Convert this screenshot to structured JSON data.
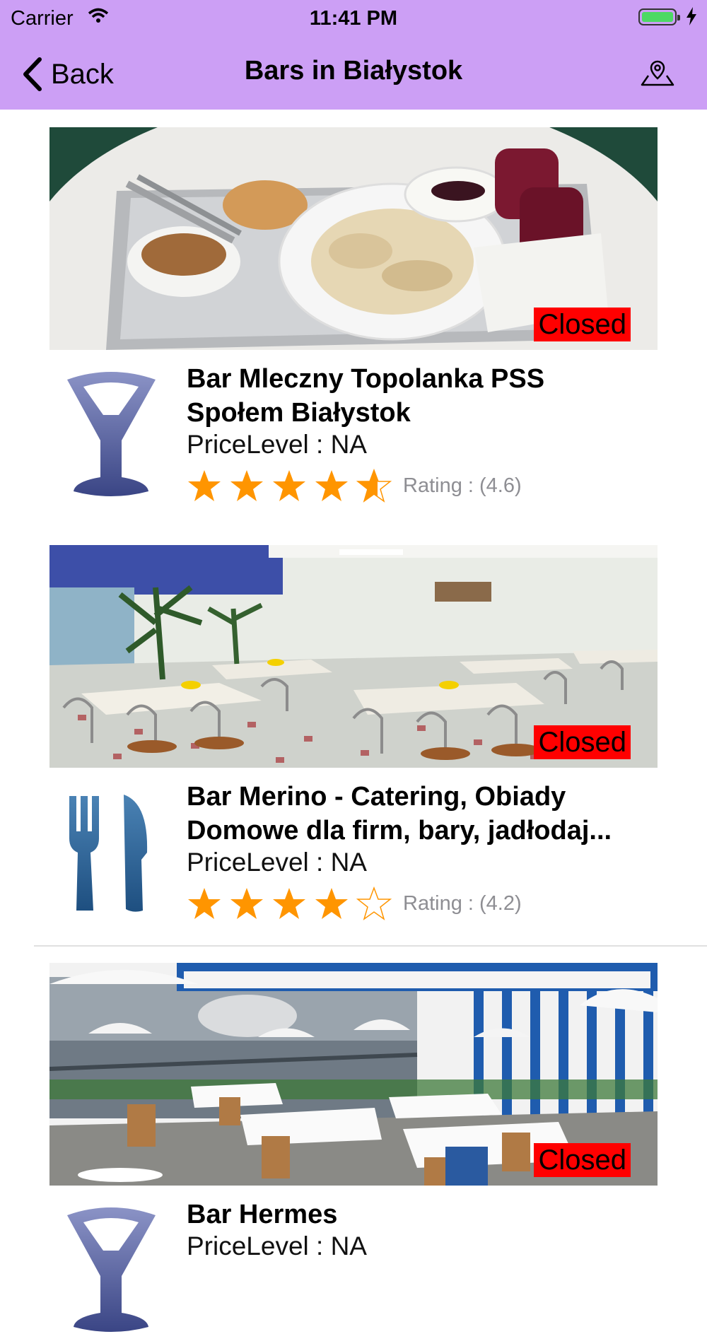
{
  "status_bar": {
    "carrier": "Carrier",
    "time": "11:41 PM"
  },
  "nav": {
    "back_label": "Back",
    "title": "Bars in Białystok"
  },
  "places": [
    {
      "name_line1": "Bar Mleczny Topolanka PSS",
      "name_line2": "Społem Białystok",
      "price_level": "PriceLevel : NA",
      "rating_text": "Rating : (4.6)",
      "rating_value": 4.6,
      "status": "Closed",
      "category_icon": "cocktail-glass-icon",
      "photo": "cafeteria tray with pierogi, soup and drinks"
    },
    {
      "name_line1": "Bar Merino - Catering, Obiady",
      "name_line2": "Domowe dla firm, bary, jadłodaj...",
      "price_level": "PriceLevel : NA",
      "rating_text": "Rating : (4.2)",
      "rating_value": 4.2,
      "status": "Closed",
      "category_icon": "fork-knife-icon",
      "photo": "dining hall with tables and chairs"
    },
    {
      "name_line1": "Bar Hermes",
      "name_line2": "",
      "price_level": "PriceLevel : NA",
      "status": "Closed",
      "category_icon": "cocktail-glass-icon",
      "photo": "restaurant interior with blue striped wall"
    }
  ],
  "colors": {
    "nav_bg": "#cc9ff5",
    "closed_badge": "#ff0000",
    "star": "#ff9500",
    "icon_glass": "#4a548f",
    "icon_cutlery": "#2f5f8f"
  }
}
